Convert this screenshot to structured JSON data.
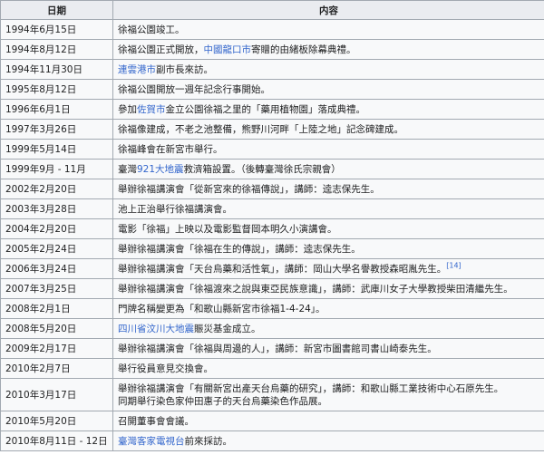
{
  "table": {
    "headers": {
      "date": "日期",
      "content": "内容"
    },
    "rows": [
      {
        "date": "1994年6月15日",
        "content": [
          {
            "text": "徐福公園竣工。"
          }
        ]
      },
      {
        "date": "1994年8月12日",
        "content": [
          {
            "text": "徐福公園正式開放，"
          },
          {
            "text": "中國",
            "link": true
          },
          {
            "text": "龍口市",
            "link": true
          },
          {
            "text": "寄贈的由緒板除幕典禮。"
          }
        ]
      },
      {
        "date": "1994年11月30日",
        "content": [
          {
            "text": "連雲港市",
            "link": true
          },
          {
            "text": "副市長來訪。"
          }
        ]
      },
      {
        "date": "1995年8月12日",
        "content": [
          {
            "text": "徐福公園開放一週年記念行事開始。"
          }
        ]
      },
      {
        "date": "1996年6月1日",
        "content": [
          {
            "text": "參加"
          },
          {
            "text": "佐賀市",
            "link": true
          },
          {
            "text": "金立公園徐福之里的「藥用植物園」落成典禮。"
          }
        ]
      },
      {
        "date": "1997年3月26日",
        "content": [
          {
            "text": "徐福像建成，不老之池整備，熊野川河畔「上陸之地」記念碑建成。"
          }
        ]
      },
      {
        "date": "1999年5月14日",
        "content": [
          {
            "text": "徐福峰會在新宮市舉行。"
          }
        ]
      },
      {
        "date": "1999年9月 - 11月",
        "content": [
          {
            "text": "臺灣"
          },
          {
            "text": "921大地震",
            "link": true
          },
          {
            "text": "救濟箱設置。（後轉臺灣徐氏宗親會）"
          }
        ]
      },
      {
        "date": "2002年2月20日",
        "content": [
          {
            "text": "舉辦徐福講演會「從新宮來的徐福傳說」，講師：逵志保先生。"
          }
        ]
      },
      {
        "date": "2003年3月28日",
        "content": [
          {
            "text": "池上正治舉行徐福講演會。"
          }
        ]
      },
      {
        "date": "2004年2月20日",
        "content": [
          {
            "text": "電影「徐福」上映以及電影監督岡本明久小演講會。"
          }
        ]
      },
      {
        "date": "2005年2月24日",
        "content": [
          {
            "text": "舉辦徐福講演會「徐福在生的傳說」，講師：逵志保先生。"
          }
        ]
      },
      {
        "date": "2006年3月24日",
        "content": [
          {
            "text": "舉辦徐福講演會「天台烏藥和活性氧」，講師：岡山大學名譽教授森昭胤先生。"
          },
          {
            "text": "[14]",
            "link": true,
            "sup": true
          }
        ]
      },
      {
        "date": "2007年3月25日",
        "content": [
          {
            "text": "舉辦徐福講演會「徐福渡來之說與東亞民族意識」，講師：武庫川女子大學教授柴田清繼先生。"
          }
        ]
      },
      {
        "date": "2008年2月1日",
        "content": [
          {
            "text": "門牌名稱變更為「和歌山縣新宮市徐福1-4-24」。"
          }
        ]
      },
      {
        "date": "2008年5月20日",
        "content": [
          {
            "text": "四川省汶川大地震",
            "link": true
          },
          {
            "text": "賑災基金成立。"
          }
        ]
      },
      {
        "date": "2009年2月17日",
        "content": [
          {
            "text": "舉辦徐福講演會「徐福與周邊的人」，講師：新宮市圖書館司書山崎泰先生。"
          }
        ]
      },
      {
        "date": "2010年2月7日",
        "content": [
          {
            "text": "舉行役員意見交換會。"
          }
        ]
      },
      {
        "date": "2010年3月17日",
        "tall": true,
        "content": [
          {
            "text": "舉辦徐福講演會「有關新宮出產天台烏藥的研究」，講師：和歌山縣工業技術中心石原先生。"
          },
          {
            "br": true
          },
          {
            "text": "同期舉行染色家仲田惠子的天台烏藥染色作品展。"
          }
        ]
      },
      {
        "date": "2010年5月20日",
        "content": [
          {
            "text": "召開董事會會議。"
          }
        ]
      },
      {
        "date": "2010年8月11日 - 12日",
        "content": [
          {
            "text": "臺灣客家電視台",
            "link": true
          },
          {
            "text": "前來採訪。"
          }
        ]
      }
    ]
  }
}
